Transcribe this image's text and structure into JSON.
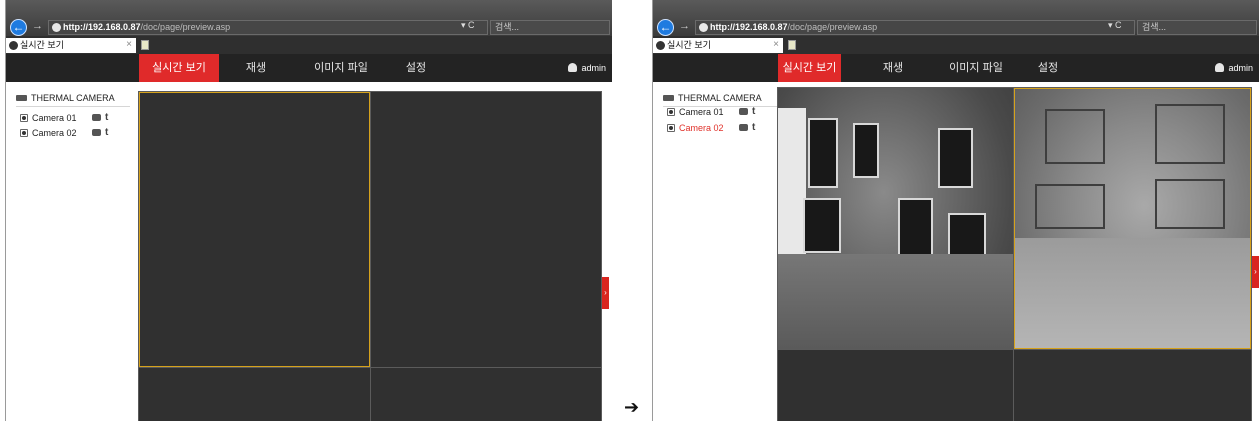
{
  "browser": {
    "url_host": "http://192.168.0.87",
    "url_path": "/doc/page/preview.asp",
    "search_placeholder": "검색...",
    "tab_title": "실시간 보기",
    "refresh_glyph": "▾ C"
  },
  "nav": {
    "items": [
      "실시간 보기",
      "재생",
      "이미지 파일",
      "설정"
    ],
    "user": "admin"
  },
  "sidebar": {
    "title": "THERMAL CAMERA",
    "cameras": [
      "Camera 01",
      "Camera 02"
    ]
  },
  "icons": {
    "back": "arrow-left-icon",
    "forward": "arrow-right-icon",
    "globe": "globe-icon",
    "user": "user-icon",
    "camera_group": "camera-group-icon",
    "record": "record-icon",
    "ptz": "ptz-icon",
    "expand": "chevron-right-icon"
  },
  "colors": {
    "accent_red": "#e02a2a",
    "selected_border": "#d6a21c",
    "panel_dark": "#303030",
    "nav_bg": "#232323"
  },
  "states": {
    "before": {
      "selected_camera": "Camera 01",
      "feeds": "none"
    },
    "after": {
      "selected_camera": "Camera 02",
      "feeds": "Camera 01, Camera 02"
    }
  },
  "separator_glyph": "➔",
  "toggle_glyph": "›"
}
